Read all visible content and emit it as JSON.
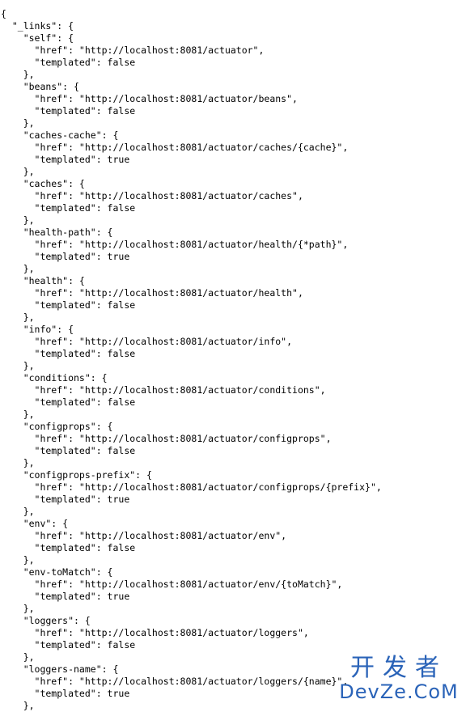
{
  "lines": [
    "{",
    "  \"_links\": {",
    "    \"self\": {",
    "      \"href\": \"http://localhost:8081/actuator\",",
    "      \"templated\": false",
    "    },",
    "    \"beans\": {",
    "      \"href\": \"http://localhost:8081/actuator/beans\",",
    "      \"templated\": false",
    "    },",
    "    \"caches-cache\": {",
    "      \"href\": \"http://localhost:8081/actuator/caches/{cache}\",",
    "      \"templated\": true",
    "    },",
    "    \"caches\": {",
    "      \"href\": \"http://localhost:8081/actuator/caches\",",
    "      \"templated\": false",
    "    },",
    "    \"health-path\": {",
    "      \"href\": \"http://localhost:8081/actuator/health/{*path}\",",
    "      \"templated\": true",
    "    },",
    "    \"health\": {",
    "      \"href\": \"http://localhost:8081/actuator/health\",",
    "      \"templated\": false",
    "    },",
    "    \"info\": {",
    "      \"href\": \"http://localhost:8081/actuator/info\",",
    "      \"templated\": false",
    "    },",
    "    \"conditions\": {",
    "      \"href\": \"http://localhost:8081/actuator/conditions\",",
    "      \"templated\": false",
    "    },",
    "    \"configprops\": {",
    "      \"href\": \"http://localhost:8081/actuator/configprops\",",
    "      \"templated\": false",
    "    },",
    "    \"configprops-prefix\": {",
    "      \"href\": \"http://localhost:8081/actuator/configprops/{prefix}\",",
    "      \"templated\": true",
    "    },",
    "    \"env\": {",
    "      \"href\": \"http://localhost:8081/actuator/env\",",
    "      \"templated\": false",
    "    },",
    "    \"env-toMatch\": {",
    "      \"href\": \"http://localhost:8081/actuator/env/{toMatch}\",",
    "      \"templated\": true",
    "    },",
    "    \"loggers\": {",
    "      \"href\": \"http://localhost:8081/actuator/loggers\",",
    "      \"templated\": false",
    "    },",
    "    \"loggers-name\": {",
    "      \"href\": \"http://localhost:8081/actuator/loggers/{name}\",",
    "      \"templated\": true",
    "    },"
  ],
  "watermark": {
    "cn": "开发者",
    "en": "DevZe.CoM"
  }
}
